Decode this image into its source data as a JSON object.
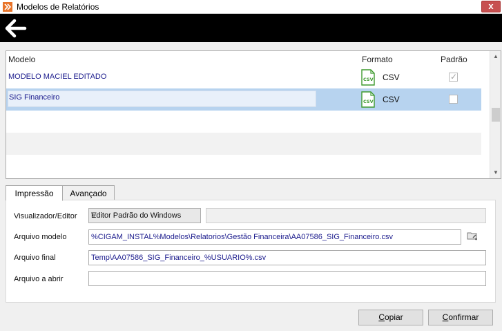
{
  "window": {
    "title": "Modelos de Relatórios",
    "close_label": "x"
  },
  "grid": {
    "headers": {
      "model": "Modelo",
      "format": "Formato",
      "default": "Padrão"
    },
    "rows": [
      {
        "model": "MODELO MACIEL EDITADO",
        "format": "CSV",
        "default": true,
        "selected": false
      },
      {
        "model": "SIG Financeiro",
        "format": "CSV",
        "default": false,
        "selected": true
      }
    ]
  },
  "tabs": {
    "impressao": "Impressão",
    "avancado": "Avançado"
  },
  "form": {
    "visualizador_label": "Visualizador/Editor",
    "visualizador_value": "Editor Padrão do Windows",
    "arquivo_modelo_label": "Arquivo modelo",
    "arquivo_modelo_value": "%CIGAM_INSTAL%Modelos\\Relatorios\\Gestão Financeira\\AA07586_SIG_Financeiro.csv",
    "arquivo_final_label": "Arquivo final",
    "arquivo_final_value": "Temp\\AA07586_SIG_Financeiro_%USUARIO%.csv",
    "arquivo_abrir_label": "Arquivo a abrir",
    "arquivo_abrir_value": ""
  },
  "buttons": {
    "copiar": {
      "first": "C",
      "rest": "opiar"
    },
    "confirmar": {
      "first": "C",
      "rest": "onfirmar"
    }
  },
  "colors": {
    "selected_row": "#b7d3ef",
    "link_text": "#1a1a8c",
    "csv_icon": "#3f9a2f",
    "toolbar": "#000000"
  },
  "icons": {
    "app": "app-logo-icon",
    "back": "arrow-left-icon",
    "csv": "csv-file-icon",
    "browse": "folder-browse-icon"
  }
}
